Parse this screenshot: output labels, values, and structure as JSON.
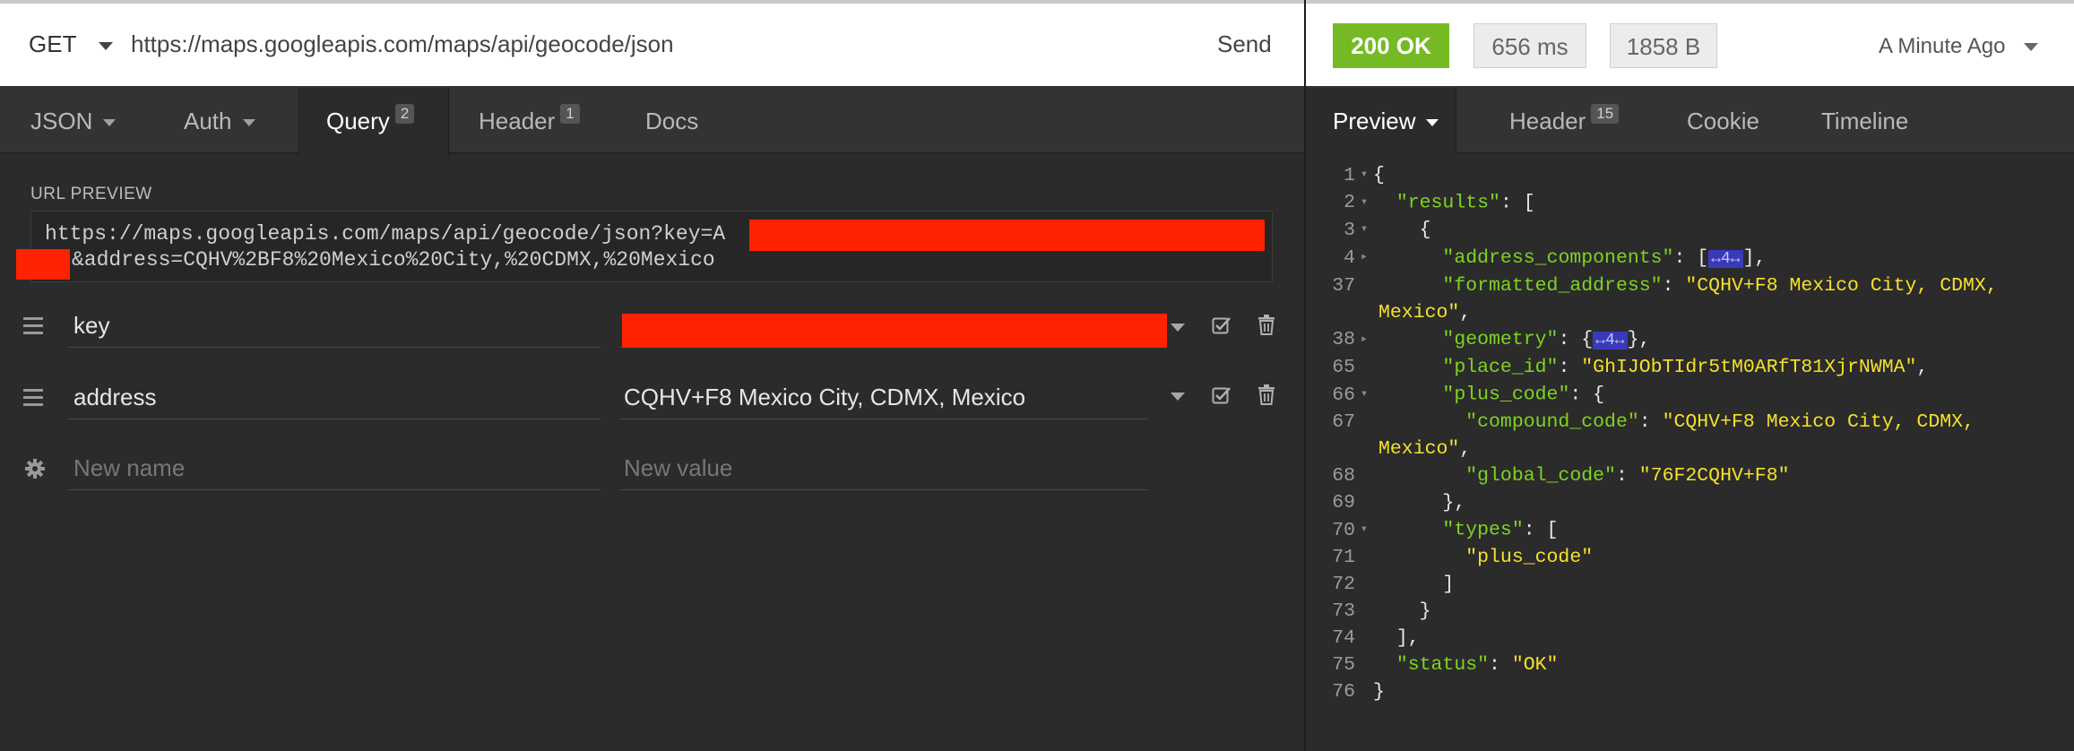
{
  "request": {
    "method": "GET",
    "url": "https://maps.googleapis.com/maps/api/geocode/json",
    "send_label": "Send"
  },
  "response_meta": {
    "status": "200 OK",
    "time": "656 ms",
    "size": "1858 B",
    "when": "A Minute Ago"
  },
  "request_tabs": [
    {
      "label": "JSON"
    },
    {
      "label": "Auth"
    },
    {
      "label": "Query",
      "count": "2"
    },
    {
      "label": "Header",
      "count": "1"
    },
    {
      "label": "Docs"
    }
  ],
  "response_tabs": [
    {
      "label": "Preview"
    },
    {
      "label": "Header",
      "count": "15"
    },
    {
      "label": "Cookie"
    },
    {
      "label": "Timeline"
    }
  ],
  "url_preview": {
    "label": "URL PREVIEW",
    "line1": "https://maps.googleapis.com/maps/api/geocode/json?key=A",
    "line2": "&address=CQHV%2BF8%20Mexico%20City,%20CDMX,%20Mexico"
  },
  "params": [
    {
      "name": "key",
      "value": ""
    },
    {
      "name": "address",
      "value": "CQHV+F8 Mexico City, CDMX, Mexico"
    }
  ],
  "new_param": {
    "name_placeholder": "New name",
    "value_placeholder": "New value"
  },
  "colors": {
    "accent_ok": "#75ba24",
    "redaction": "#ff2200",
    "json_key": "#7ed321",
    "json_string": "#f5e12b"
  },
  "icons": [
    "chevron-down-icon",
    "drag-handle-icon",
    "gear-icon",
    "checkbox-icon",
    "trash-icon"
  ],
  "json_preview": {
    "lines": [
      {
        "n": "1",
        "fold": "▾",
        "indent": 0,
        "html": "<span class='p'>{</span>"
      },
      {
        "n": "2",
        "fold": "▾",
        "indent": 1,
        "html": "<span class='k'>\"results\"</span><span class='p'>: [</span>"
      },
      {
        "n": "3",
        "fold": "▾",
        "indent": 2,
        "html": "<span class='p'>{</span>"
      },
      {
        "n": "4",
        "fold": "▸",
        "indent": 3,
        "html": "<span class='k'>\"address_components\"</span><span class='p'>: [</span><span class='coll'>↔4↔</span><span class='p'>],</span>"
      },
      {
        "n": "37",
        "fold": "",
        "indent": 3,
        "html": "<span class='k'>\"formatted_address\"</span><span class='p'>: </span><span class='s'>\"CQHV+F8 Mexico City, CDMX,</span>"
      },
      {
        "n": "",
        "fold": "",
        "indent": 0,
        "html": "<span class='s'>Mexico\"</span><span class='p'>,</span>"
      },
      {
        "n": "38",
        "fold": "▸",
        "indent": 3,
        "html": "<span class='k'>\"geometry\"</span><span class='p'>: {</span><span class='coll'>↔4↔</span><span class='p'>},</span>"
      },
      {
        "n": "65",
        "fold": "",
        "indent": 3,
        "html": "<span class='k'>\"place_id\"</span><span class='p'>: </span><span class='s'>\"GhIJObTIdr5tM0ARfT81XjrNWMA\"</span><span class='p'>,</span>"
      },
      {
        "n": "66",
        "fold": "▾",
        "indent": 3,
        "html": "<span class='k'>\"plus_code\"</span><span class='p'>: {</span>"
      },
      {
        "n": "67",
        "fold": "",
        "indent": 4,
        "html": "<span class='k'>\"compound_code\"</span><span class='p'>: </span><span class='s'>\"CQHV+F8 Mexico City, CDMX,</span>"
      },
      {
        "n": "",
        "fold": "",
        "indent": 0,
        "html": "<span class='s'>Mexico\"</span><span class='p'>,</span>"
      },
      {
        "n": "68",
        "fold": "",
        "indent": 4,
        "html": "<span class='k'>\"global_code\"</span><span class='p'>: </span><span class='s'>\"76F2CQHV+F8\"</span>"
      },
      {
        "n": "69",
        "fold": "",
        "indent": 3,
        "html": "<span class='p'>},</span>"
      },
      {
        "n": "70",
        "fold": "▾",
        "indent": 3,
        "html": "<span class='k'>\"types\"</span><span class='p'>: [</span>"
      },
      {
        "n": "71",
        "fold": "",
        "indent": 4,
        "html": "<span class='s'>\"plus_code\"</span>"
      },
      {
        "n": "72",
        "fold": "",
        "indent": 3,
        "html": "<span class='p'>]</span>"
      },
      {
        "n": "73",
        "fold": "",
        "indent": 2,
        "html": "<span class='p'>}</span>"
      },
      {
        "n": "74",
        "fold": "",
        "indent": 1,
        "html": "<span class='p'>],</span>"
      },
      {
        "n": "75",
        "fold": "",
        "indent": 1,
        "html": "<span class='k'>\"status\"</span><span class='p'>: </span><span class='s'>\"OK\"</span>"
      },
      {
        "n": "76",
        "fold": "",
        "indent": 0,
        "html": "<span class='p'>}</span>"
      }
    ]
  }
}
